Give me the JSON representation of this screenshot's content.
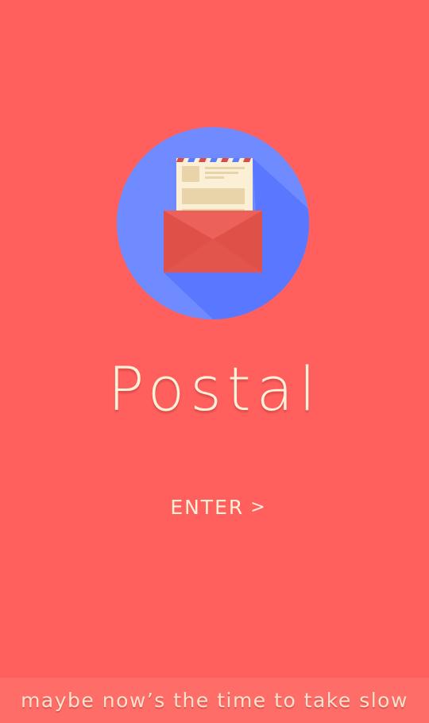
{
  "app": {
    "title": "Postal",
    "logo_icon": "envelope-letter-icon"
  },
  "actions": {
    "enter_label": "ENTER",
    "enter_chevron": ">"
  },
  "footer": {
    "tagline": "maybe now’s the time to take slow"
  },
  "colors": {
    "background": "#ff605e",
    "footer_band": "#ff6d69",
    "text": "#fdf1da",
    "logo_circle": "#6f8bff",
    "envelope": "#e85a52",
    "letter": "#fbf0d5"
  }
}
